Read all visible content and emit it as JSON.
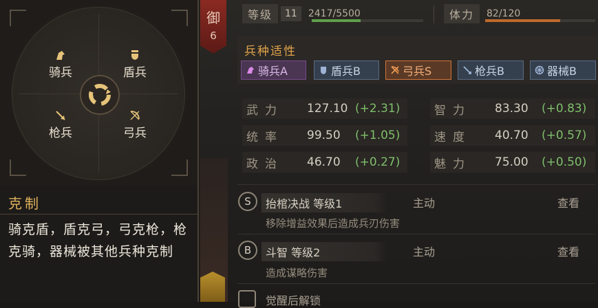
{
  "counter_panel": {
    "units": [
      {
        "name": "骑兵",
        "icon": "cavalry-icon"
      },
      {
        "name": "盾兵",
        "icon": "shield-icon"
      },
      {
        "name": "枪兵",
        "icon": "spear-icon"
      },
      {
        "name": "弓兵",
        "icon": "bow-icon"
      }
    ],
    "center_icon": "cycle-arrows-icon",
    "title": "克制",
    "description": "骑克盾，盾克弓，弓克枪，枪克骑，器械被其他兵种克制"
  },
  "header": {
    "defense_label": "御",
    "defense_value": "6",
    "level_label": "等级",
    "level_value": "11",
    "exp_text": "2417/5500",
    "exp_fraction": 0.439,
    "stamina_label": "体力",
    "stamina_text": "82/120",
    "stamina_fraction": 0.683
  },
  "affinity": {
    "title": "兵种适性",
    "items": [
      {
        "label": "骑兵A",
        "icon": "cavalry-icon",
        "selected": false,
        "style": "purple"
      },
      {
        "label": "盾兵B",
        "icon": "shield-icon",
        "selected": false,
        "style": "blue"
      },
      {
        "label": "弓兵S",
        "icon": "bow-icon",
        "selected": true,
        "style": "orange"
      },
      {
        "label": "枪兵B",
        "icon": "spear-icon",
        "selected": false,
        "style": "blue"
      },
      {
        "label": "器械B",
        "icon": "siege-icon",
        "selected": false,
        "style": "blue"
      }
    ]
  },
  "attributes": [
    {
      "name": "武力",
      "value": "127.10",
      "bonus": "(+2.31)"
    },
    {
      "name": "智力",
      "value": "83.30",
      "bonus": "(+0.83)"
    },
    {
      "name": "统率",
      "value": "99.50",
      "bonus": "(+1.05)"
    },
    {
      "name": "速度",
      "value": "40.70",
      "bonus": "(+0.57)"
    },
    {
      "name": "政治",
      "value": "46.70",
      "bonus": "(+0.27)"
    },
    {
      "name": "魅力",
      "value": "75.00",
      "bonus": "(+0.50)"
    }
  ],
  "skills": [
    {
      "grade": "S",
      "name": "抬棺决战 等级1",
      "type": "主动",
      "view": "查看",
      "desc": "移除增益效果后造成兵刃伤害"
    },
    {
      "grade": "B",
      "name": "斗智 等级2",
      "type": "主动",
      "view": "查看",
      "desc": "造成谋略伤害"
    }
  ],
  "awaken_text": "觉醒后解锁",
  "colors": {
    "accent": "#e1a44a",
    "bonus": "#7fbf6b",
    "exp": "#5fa04a",
    "stamina": "#c06a2c"
  }
}
